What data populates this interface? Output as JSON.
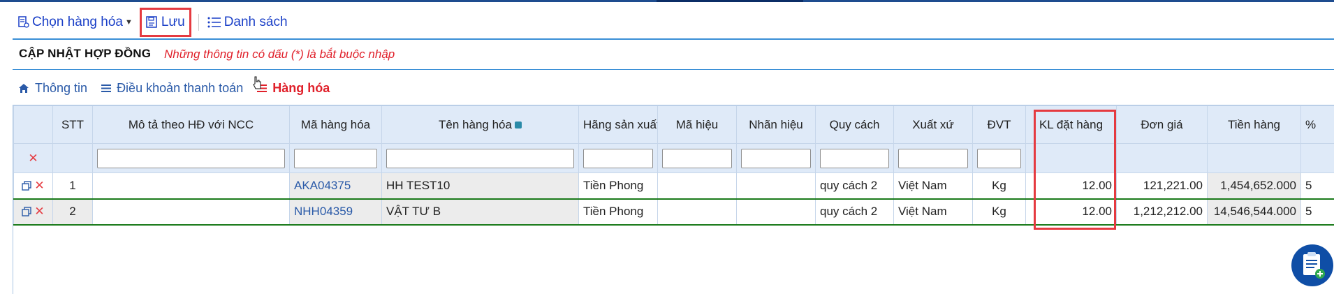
{
  "toolbar": {
    "choose_label": "Chọn hàng hóa",
    "save_label": "Lưu",
    "list_label": "Danh sách"
  },
  "header": {
    "title": "CẬP NHẬT HỢP ĐỒNG",
    "required_note": "Những thông tin có dấu (*) là bắt buộc nhập"
  },
  "tabs": [
    {
      "label": "Thông tin",
      "icon": "home-icon"
    },
    {
      "label": "Điều khoản thanh toán",
      "icon": "list-icon"
    },
    {
      "label": "Hàng hóa",
      "icon": "list-icon",
      "active": true
    }
  ],
  "table": {
    "columns": [
      "STT",
      "Mô tả theo HĐ với NCC",
      "Mã hàng hóa",
      "Tên hàng hóa",
      "Hãng sản xuất",
      "Mã hiệu",
      "Nhãn hiệu",
      "Quy cách",
      "Xuất xứ",
      "ĐVT",
      "KL đặt hàng",
      "Đơn giá",
      "Tiền hàng",
      "%"
    ],
    "rows": [
      {
        "stt": "1",
        "mo_ta": "",
        "ma_hang": "AKA04375",
        "ten_hang": "HH TEST10",
        "hang_sx": "Tiền Phong",
        "ma_hieu": "",
        "nhan_hieu": "",
        "quy_cach": "quy cách 2",
        "xuat_xu": "Việt Nam",
        "dvt": "Kg",
        "kl": "12.00",
        "don_gia": "121,221.00",
        "tien_hang": "1,454,652.000",
        "pct": "5"
      },
      {
        "stt": "2",
        "mo_ta": "",
        "ma_hang": "NHH04359",
        "ten_hang": "VẬT TƯ B",
        "hang_sx": "Tiền Phong",
        "ma_hieu": "",
        "nhan_hieu": "",
        "quy_cach": "quy cách 2",
        "xuat_xu": "Việt Nam",
        "dvt": "Kg",
        "kl": "12.00",
        "don_gia": "1,212,212.00",
        "tien_hang": "14,546,544.000",
        "pct": "5"
      }
    ]
  },
  "colors": {
    "accent": "#2a5aa8",
    "danger": "#e0202a",
    "highlight": "#e53a40",
    "header_bg": "#dfeaf8"
  }
}
